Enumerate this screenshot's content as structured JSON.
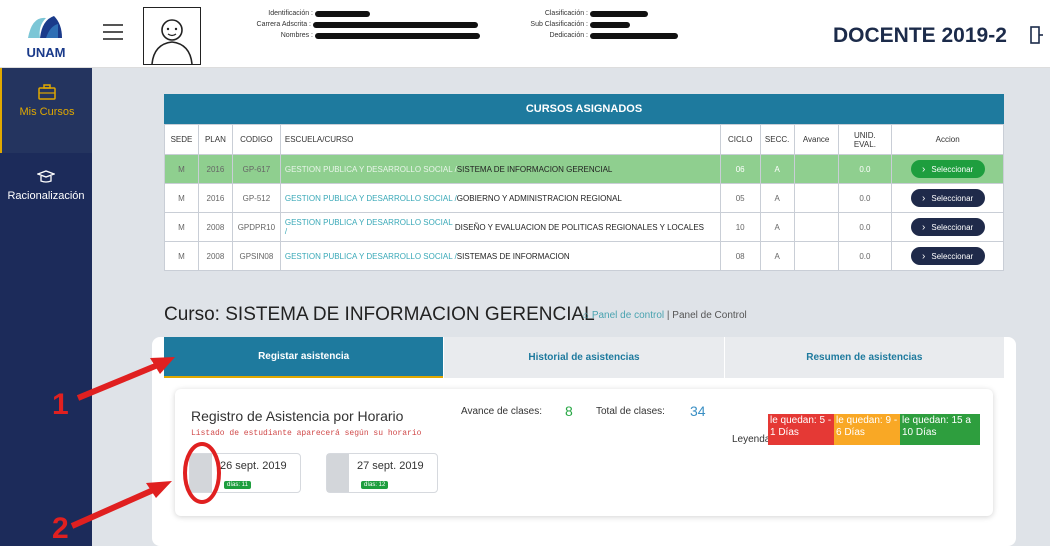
{
  "header": {
    "logo_text": "UNAM",
    "labels": {
      "identificacion": "Identificación :",
      "carrera": "Carrera Adscrita :",
      "nombres": "Nombres :",
      "clasificacion": "Clasificación :",
      "sub_clasificacion": "Sub Clasificación :",
      "dedicacion": "Dedicación :"
    },
    "role": "DOCENTE 2019-2"
  },
  "sidebar": {
    "items": [
      {
        "label": "Mis Cursos",
        "icon": "briefcase-icon",
        "active": true
      },
      {
        "label": "Racionalización",
        "icon": "graduation-cap-icon",
        "active": false
      }
    ]
  },
  "courses": {
    "title": "CURSOS ASIGNADOS",
    "headers": [
      "SEDE",
      "PLAN",
      "CODIGO",
      "ESCUELA/CURSO",
      "CICLO",
      "SECC.",
      "Avance",
      "UNID. EVAL.",
      "Accion"
    ],
    "button_label": "Seleccionar",
    "rows": [
      {
        "sede": "M",
        "plan": "2016",
        "codigo": "GP-617",
        "escuela": "GESTION PUBLICA Y DESARROLLO SOCIAL /",
        "curso": "SISTEMA DE INFORMACION GERENCIAL",
        "ciclo": "06",
        "secc": "A",
        "avance": "",
        "unid": "0.0"
      },
      {
        "sede": "M",
        "plan": "2016",
        "codigo": "GP-512",
        "escuela": "GESTION PUBLICA Y DESARROLLO SOCIAL /",
        "curso": "GOBIERNO Y ADMINISTRACION REGIONAL",
        "ciclo": "05",
        "secc": "A",
        "avance": "",
        "unid": "0.0"
      },
      {
        "sede": "M",
        "plan": "2008",
        "codigo": "GPDPR10",
        "escuela": "GESTION PUBLICA Y DESARROLLO SOCIAL /",
        "curso": "DISEÑO Y EVALUACION DE POLITICAS REGIONALES Y LOCALES",
        "ciclo": "10",
        "secc": "A",
        "avance": "",
        "unid": "0.0"
      },
      {
        "sede": "M",
        "plan": "2008",
        "codigo": "GPSIN08",
        "escuela": "GESTION PUBLICA Y DESARROLLO SOCIAL /",
        "curso": "SISTEMAS DE INFORMACION",
        "ciclo": "08",
        "secc": "A",
        "avance": "",
        "unid": "0.0"
      }
    ]
  },
  "course_section": {
    "title": "Curso: SISTEMA DE INFORMACION GERENCIAL",
    "crumb_link": "Panel de control",
    "crumb_sep": "|",
    "crumb_current": "Panel de Control"
  },
  "tabs": [
    "Registar asistencia",
    "Historial de asistencias",
    "Resumen de asistencias"
  ],
  "registro": {
    "title": "Registro de Asistencia por Horario",
    "subtitle": "Listado de estudiante aparecerá según su horario",
    "avance_label": "Avance de clases:",
    "avance_value": "8",
    "total_label": "Total de clases:",
    "total_value": "34",
    "leyenda_label": "Leyenda",
    "leyenda": [
      {
        "text": "le quedan: 5 - 1 Días",
        "color": "#e53935"
      },
      {
        "text": "le quedan: 9 - 6 Días",
        "color": "#f9a825"
      },
      {
        "text": "le quedan: 15 a 10 Días",
        "color": "#2e9e3e"
      }
    ],
    "dates": [
      {
        "date": "26 sept. 2019",
        "badge": "días: 11"
      },
      {
        "date": "27 sept. 2019",
        "badge": "días: 12"
      }
    ]
  },
  "annotations": [
    "1",
    "2"
  ],
  "colors": {
    "accent": "#1e7a9e",
    "sidebar": "#1c2b5a",
    "highlight": "#e0a800",
    "annotation": "#e02020"
  }
}
